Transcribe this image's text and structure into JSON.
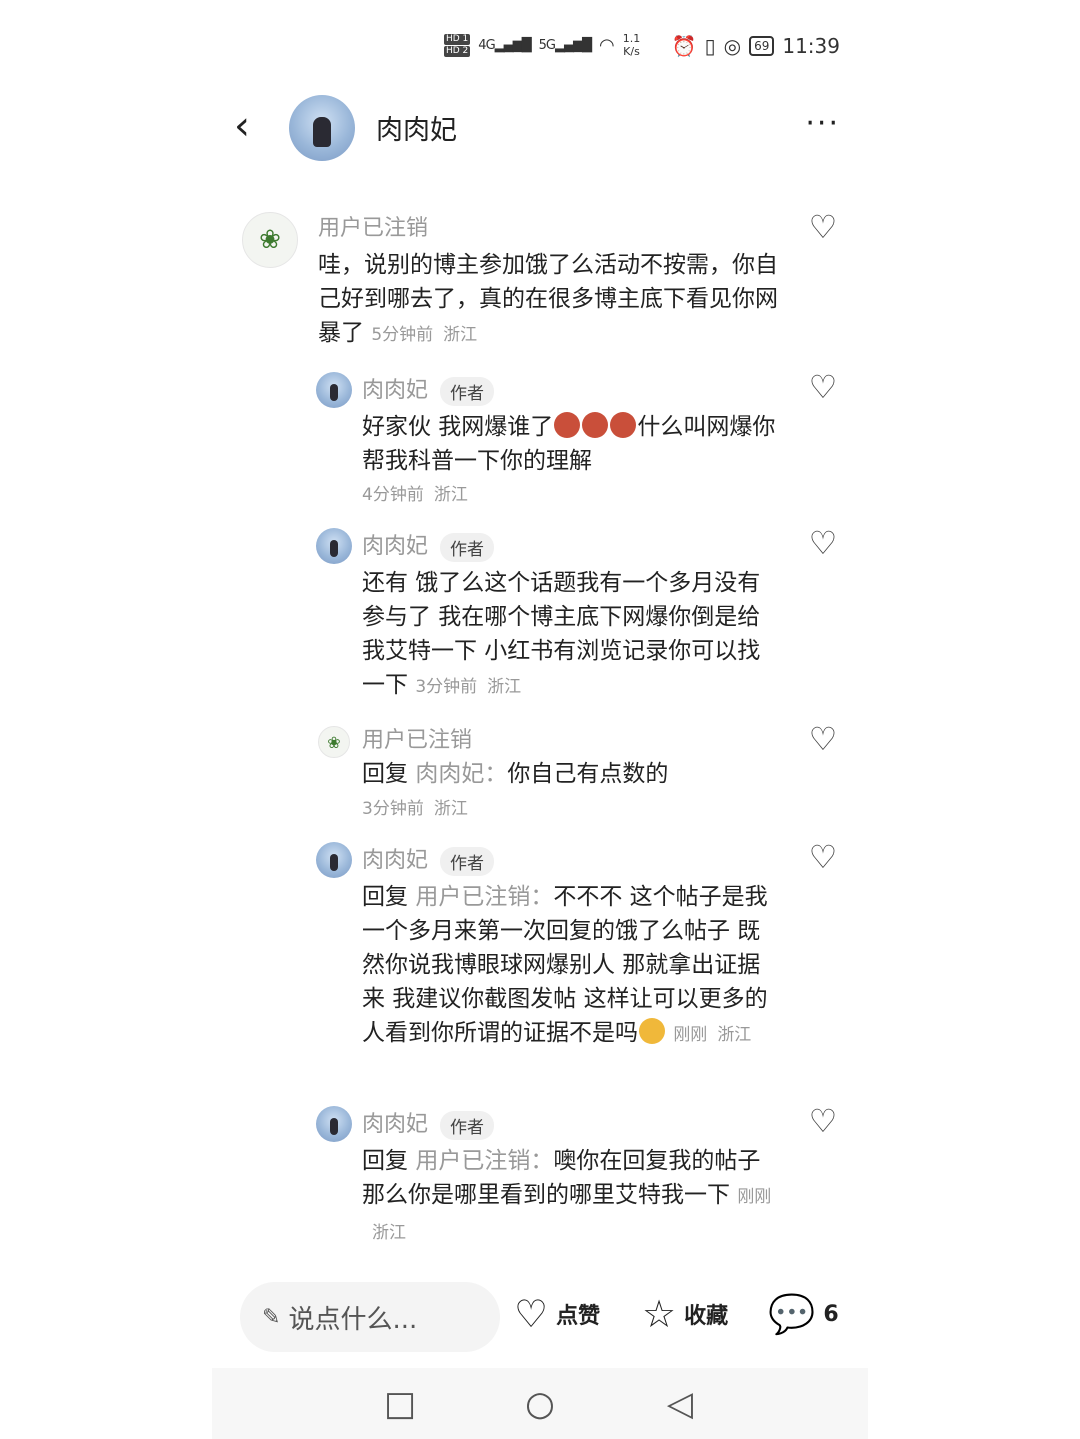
{
  "status_bar": {
    "hd1": "HD 1",
    "hd2": "HD 2",
    "sig1": "4G",
    "sig2": "5G",
    "speed_value": "1.1",
    "speed_unit": "K/s",
    "battery": "69",
    "time": "11:39"
  },
  "header": {
    "back_glyph": "‹",
    "name": "肉肉妃",
    "more_glyph": "···"
  },
  "comments": [
    {
      "name": "用户已注销",
      "text": "哇，说别的博主参加饿了么活动不按需，你自己好到哪去了，真的在很多博主底下看见你网暴了",
      "time": "5分钟前",
      "loc": "浙江"
    },
    {
      "name": "肉肉妃",
      "tag": "作者",
      "text_a": "好家伙 我网爆谁了",
      "text_b": "什么叫网爆你帮我科普一下你的理解",
      "time": "4分钟前",
      "loc": "浙江"
    },
    {
      "name": "肉肉妃",
      "tag": "作者",
      "text": "还有 饿了么这个话题我有一个多月没有参与了 我在哪个博主底下网爆你倒是给我艾特一下 小红书有浏览记录你可以找一下",
      "time": "3分钟前",
      "loc": "浙江"
    },
    {
      "name": "用户已注销",
      "reply_prefix": "回复",
      "reply_to": "肉肉妃：",
      "text": "你自己有点数的",
      "time": "3分钟前",
      "loc": "浙江"
    },
    {
      "name": "肉肉妃",
      "tag": "作者",
      "reply_prefix": "回复",
      "reply_to": "用户已注销：",
      "text": "不不不 这个帖子是我一个多月来第一次回复的饿了么帖子 既然你说我博眼球网爆别人 那就拿出证据来 我建议你截图发帖 这样让可以更多的人看到你所谓的证据不是吗",
      "time": "刚刚",
      "loc": "浙江"
    },
    {
      "name": "肉肉妃",
      "tag": "作者",
      "reply_prefix": "回复",
      "reply_to": "用户已注销：",
      "text": "噢你在回复我的帖子 那么你是哪里看到的哪里艾特我一下",
      "time": "刚刚",
      "loc": "浙江"
    }
  ],
  "bottom_bar": {
    "input_placeholder": "说点什么...",
    "like_label": "点赞",
    "collect_label": "收藏",
    "comment_count": "6"
  },
  "icons": {
    "heart": "heart-icon",
    "star": "star-icon",
    "comment": "comment-bubble-icon",
    "pencil": "pencil-icon"
  }
}
